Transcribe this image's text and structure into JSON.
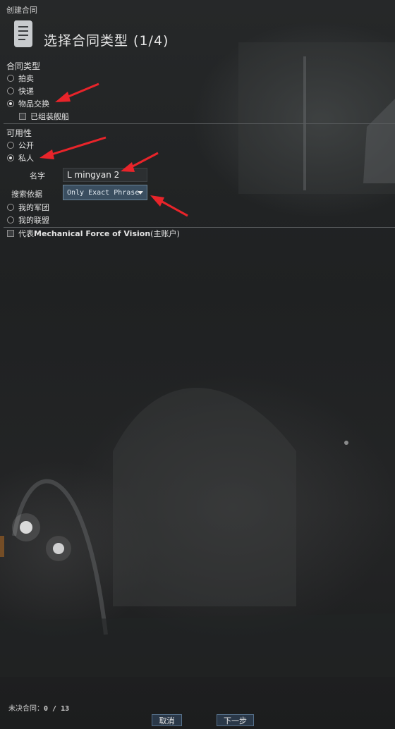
{
  "window": {
    "title": "创建合同"
  },
  "header": {
    "title": "选择合同类型 (1/4)",
    "icon": "contract-scroll-icon"
  },
  "contract_type": {
    "label": "合同类型",
    "options": [
      {
        "label": "拍卖",
        "selected": false
      },
      {
        "label": "快递",
        "selected": false
      },
      {
        "label": "物品交换",
        "selected": true
      }
    ],
    "assembled_ship_label": "已组装舰船",
    "assembled_ship_checked": false
  },
  "availability": {
    "label": "可用性",
    "options": [
      {
        "label": "公开",
        "selected": false
      },
      {
        "label": "私人",
        "selected": true
      },
      {
        "label": "我的军团",
        "selected": false
      },
      {
        "label": "我的联盟",
        "selected": false
      }
    ],
    "name_label": "名字",
    "name_value": "L mingyan 2",
    "search_label": "搜索依据",
    "search_value": "Only Exact Phrase"
  },
  "on_behalf": {
    "prefix": "代表",
    "name": "Mechanical Force of Vision",
    "suffix": " (主账户)",
    "checked": false
  },
  "footer": {
    "outstanding_label": "未决合同：",
    "outstanding_value": "0 / 13",
    "cancel_label": "取消",
    "next_label": "下一步"
  },
  "colors": {
    "accent_arrow": "#e8242a",
    "select_bg": "#3a4e60",
    "button_bg": "#2a3848"
  }
}
